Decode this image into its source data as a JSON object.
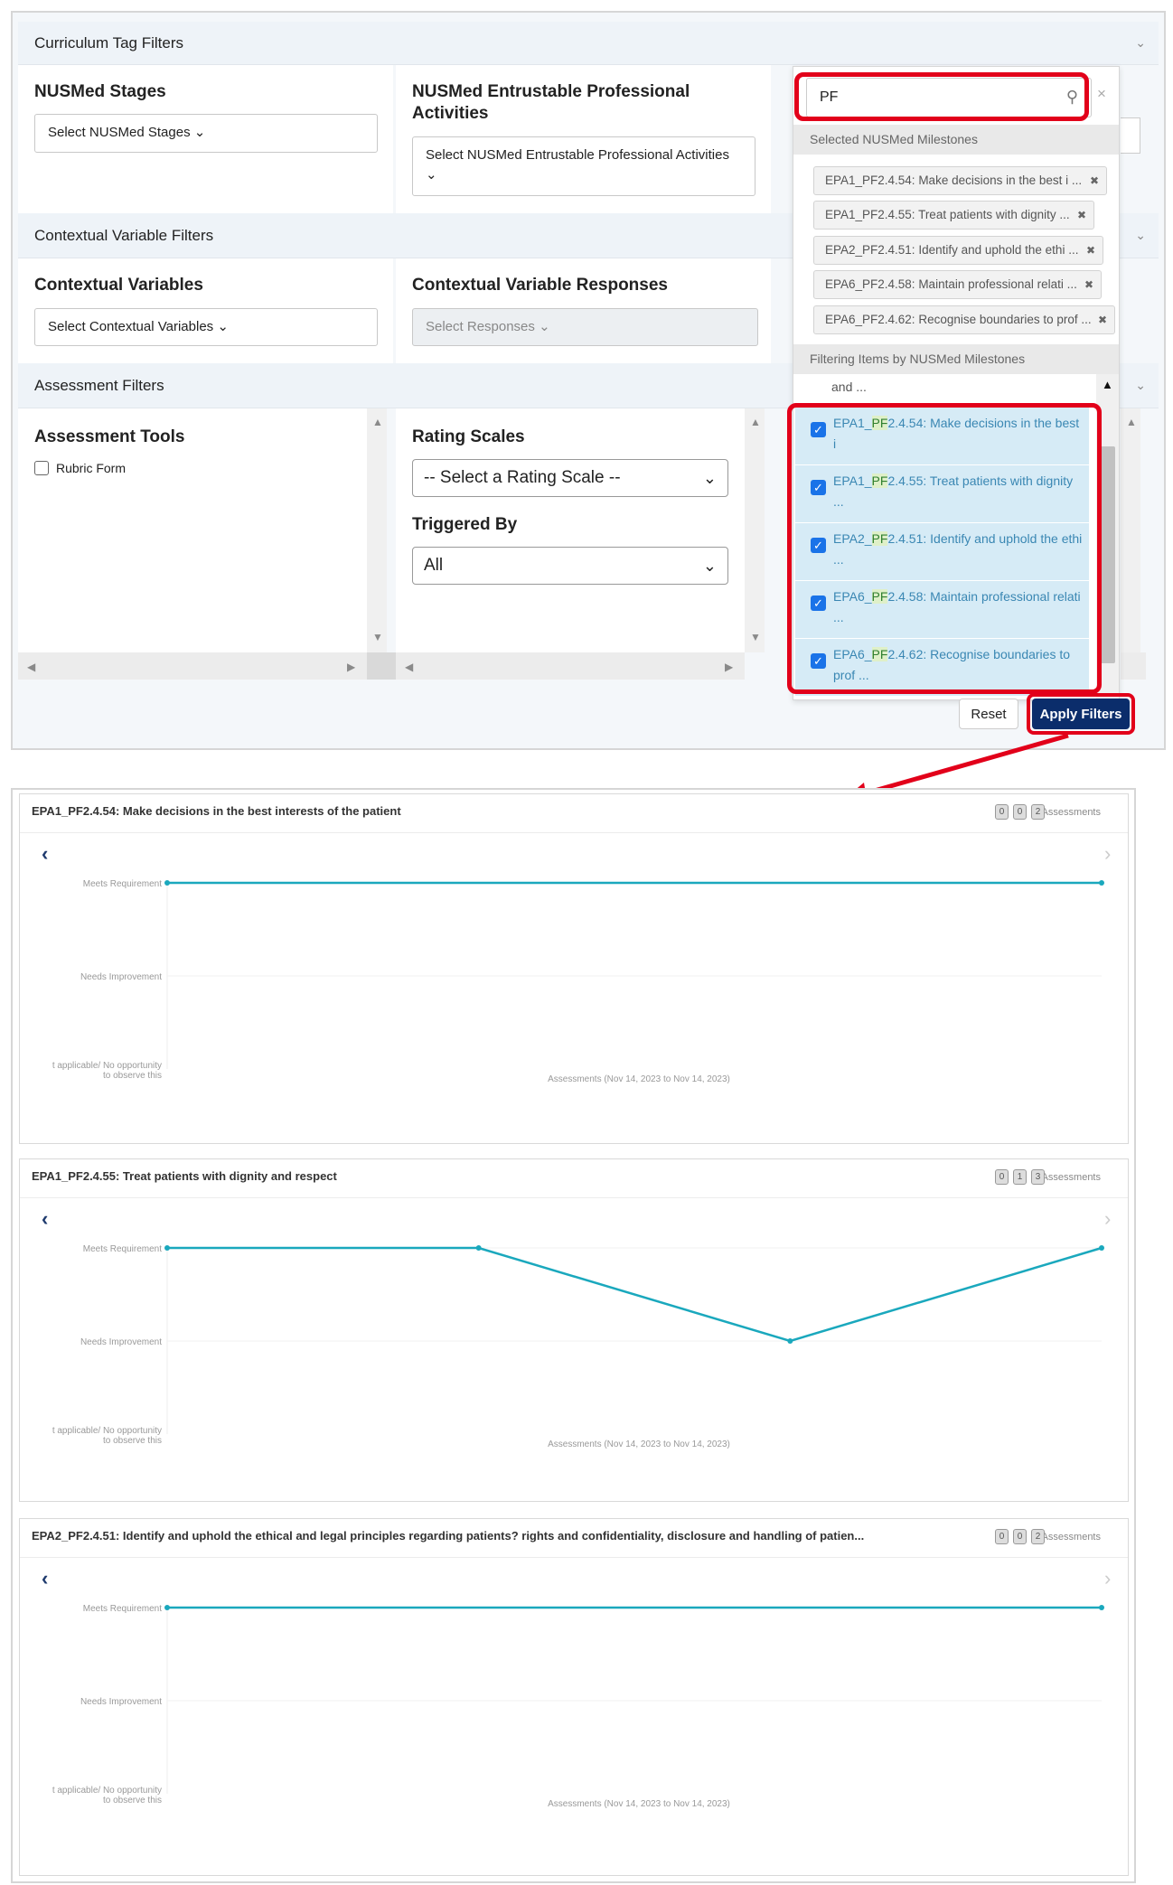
{
  "filters": {
    "curriculum_section": "Curriculum Tag Filters",
    "stages_title": "NUSMed Stages",
    "stages_select": "Select NUSMed Stages ⌄",
    "epa_title": "NUSMed Entrustable Professional Activities",
    "epa_select": "Select NUSMed Entrustable Professional Activities ⌄",
    "contextual_section": "Contextual Variable Filters",
    "cv_title": "Contextual Variables",
    "cv_select": "Select Contextual Variables ⌄",
    "cvr_title": "Contextual Variable Responses",
    "cvr_select": "Select Responses ⌄",
    "assessment_section": "Assessment Filters",
    "tools_title": "Assessment Tools",
    "tools_option": "Rubric Form",
    "rating_title": "Rating Scales",
    "rating_select": "-- Select a Rating Scale --",
    "triggered_title": "Triggered By",
    "triggered_select": "All",
    "reset_label": "Reset",
    "apply_label": "Apply Filters"
  },
  "dropdown": {
    "search_value": "PF",
    "selected_header": "Selected NUSMed Milestones",
    "selected": [
      "EPA1_PF2.4.54: Make decisions in the best i ...",
      "EPA1_PF2.4.55: Treat patients with dignity ...",
      "EPA2_PF2.4.51: Identify and uphold the ethi ...",
      "EPA6_PF2.4.58: Maintain professional relati ...",
      "EPA6_PF2.4.62: Recognise boundaries to prof ..."
    ],
    "filtering_header": "Filtering Items by NUSMed Milestones",
    "partial_item": "and ...",
    "options": [
      {
        "pre": "EPA1_",
        "hl": "PF",
        "post": "2.4.54: Make decisions in the best i",
        "cont": "..."
      },
      {
        "pre": "EPA1_",
        "hl": "PF",
        "post": "2.4.55: Treat patients with dignity",
        "cont": "..."
      },
      {
        "pre": "EPA2_",
        "hl": "PF",
        "post": "2.4.51: Identify and uphold the ethi",
        "cont": "..."
      },
      {
        "pre": "EPA6_",
        "hl": "PF",
        "post": "2.4.58: Maintain professional relati",
        "cont": "..."
      },
      {
        "pre": "EPA6_",
        "hl": "PF",
        "post": "2.4.62: Recognise boundaries to",
        "cont": "prof ..."
      }
    ]
  },
  "cards": [
    {
      "title": "EPA1_PF2.4.54: Make decisions in the best interests of the patient",
      "count": "2 Assessments",
      "chips": [
        "0",
        "0",
        "2"
      ]
    },
    {
      "title": "EPA1_PF2.4.55: Treat patients with dignity and respect",
      "count": "4 Assessments",
      "chips": [
        "0",
        "1",
        "3"
      ]
    },
    {
      "title": "EPA2_PF2.4.51: Identify and uphold the ethical and legal principles regarding patients? rights and confidentiality, disclosure and handling of patien...",
      "count": "2 Assessments",
      "chips": [
        "0",
        "0",
        "2"
      ]
    }
  ],
  "chart_axis": {
    "y_levels": [
      "Meets Requirement",
      "Needs Improvement",
      "t applicable/ No opportunity",
      "to observe this"
    ],
    "x_label": "Assessments (Nov 14, 2023 to Nov 14, 2023)"
  },
  "chart_data": [
    {
      "type": "line",
      "title": "EPA1_PF2.4.54: Make decisions in the best interests of the patient",
      "y_categories": [
        "Not applicable/ No opportunity to observe this",
        "Needs Improvement",
        "Meets Requirement"
      ],
      "series": [
        {
          "values": [
            2,
            2
          ]
        }
      ],
      "xlabel": "Assessments (Nov 14, 2023 to Nov 14, 2023)",
      "color": "#1aa8bd"
    },
    {
      "type": "line",
      "title": "EPA1_PF2.4.55: Treat patients with dignity and respect",
      "y_categories": [
        "Not applicable/ No opportunity to observe this",
        "Needs Improvement",
        "Meets Requirement"
      ],
      "series": [
        {
          "values": [
            2,
            2,
            1,
            2
          ]
        }
      ],
      "xlabel": "Assessments (Nov 14, 2023 to Nov 14, 2023)",
      "color": "#1aa8bd"
    },
    {
      "type": "line",
      "title": "EPA2_PF2.4.51: Identify and uphold the ethical and legal principles regarding patients? rights and confidentiality, disclosure and handling of patien...",
      "y_categories": [
        "Not applicable/ No opportunity to observe this",
        "Needs Improvement",
        "Meets Requirement"
      ],
      "series": [
        {
          "values": [
            2,
            2
          ]
        }
      ],
      "xlabel": "Assessments (Nov 14, 2023 to Nov 14, 2023)",
      "color": "#1aa8bd"
    }
  ],
  "colors": {
    "accent": "#1aa8bd",
    "primary_button": "#0b2d6b",
    "highlight": "#e2001a"
  }
}
